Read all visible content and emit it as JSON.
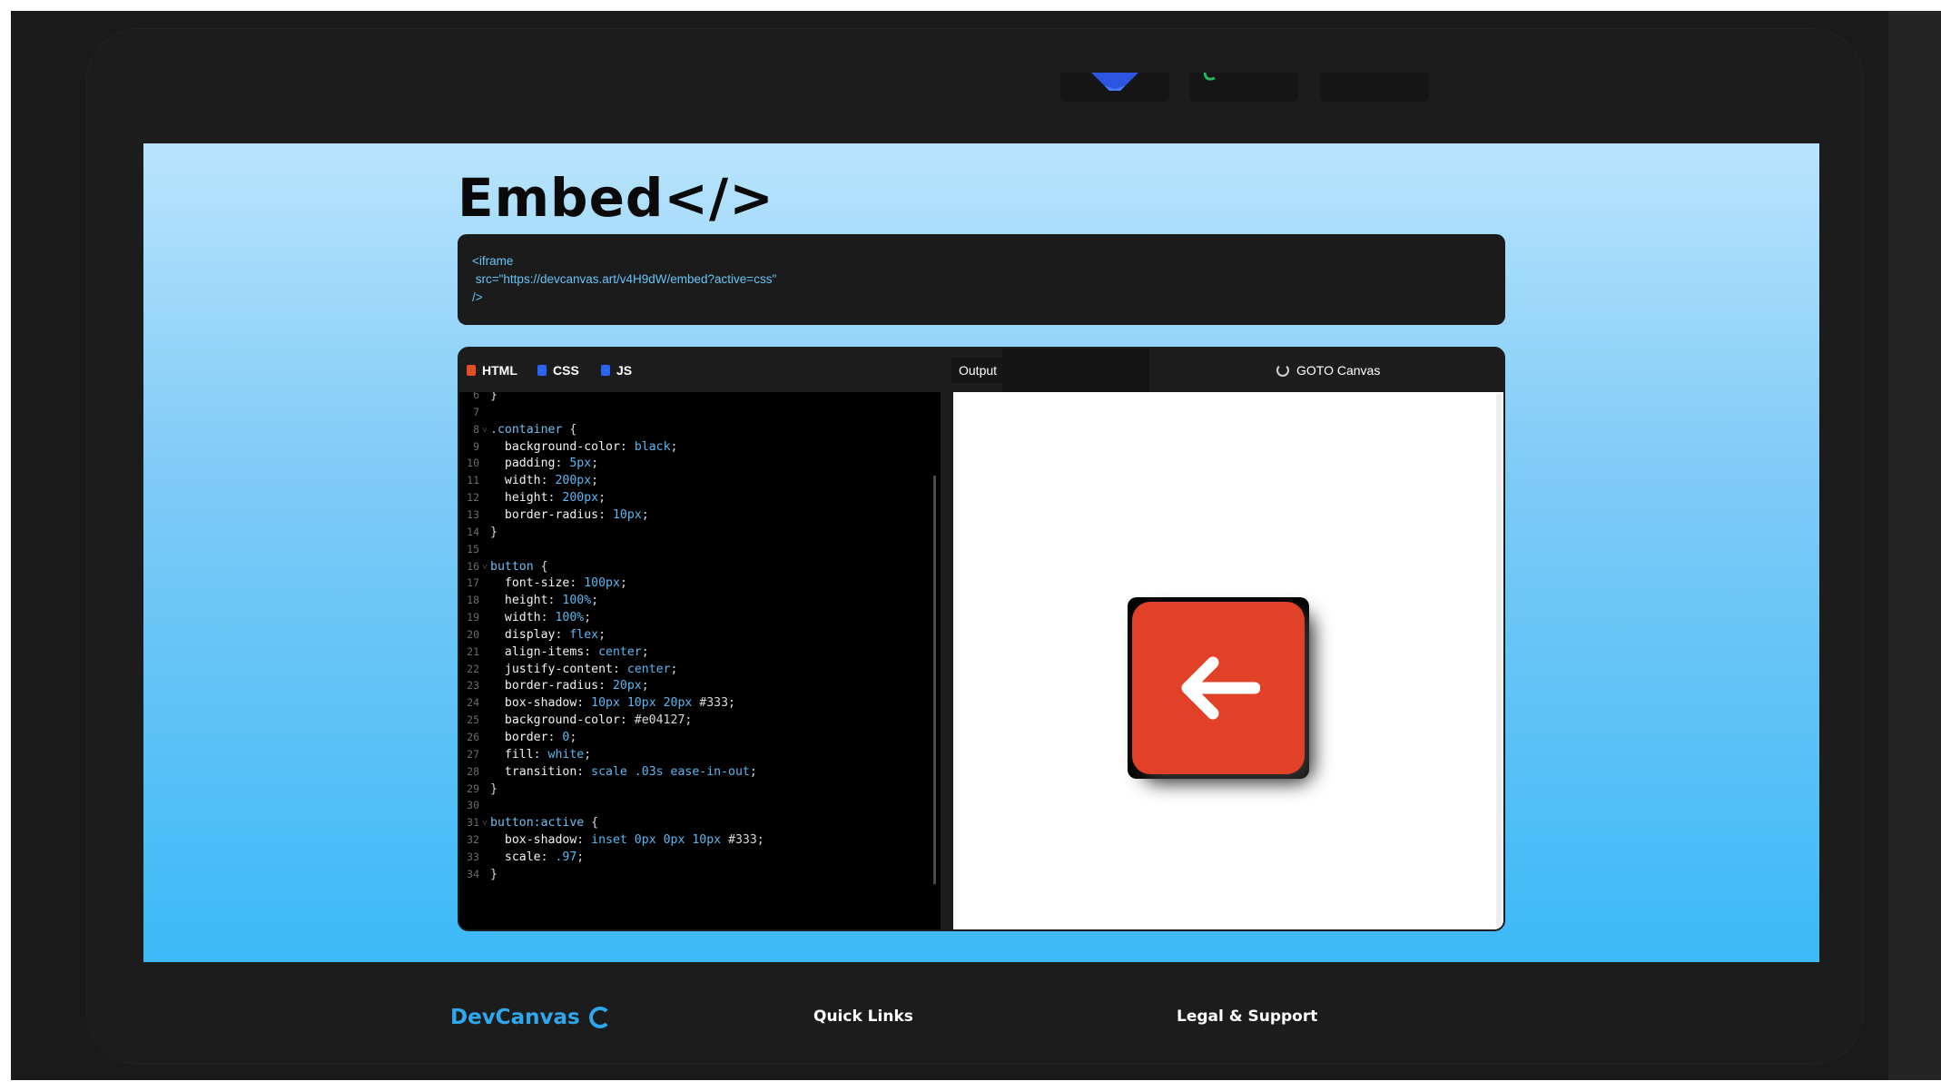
{
  "embed": {
    "title": "Embed</>",
    "code_lines": [
      "<iframe",
      " src=\"https://devcanvas.art/v4H9dW/embed?active=css\"",
      "/>"
    ]
  },
  "editor": {
    "tabs": [
      {
        "label": "HTML",
        "icon": "html5-icon",
        "color": "#e44d26"
      },
      {
        "label": "CSS",
        "icon": "css3-icon",
        "color": "#2965f1"
      },
      {
        "label": "JS",
        "icon": "js-icon",
        "color": "#2965f1"
      }
    ],
    "output_label": "Output",
    "goto_label": "GOTO Canvas",
    "code": [
      {
        "n": "6",
        "fold": "",
        "t": [
          [
            "punc",
            "}"
          ]
        ]
      },
      {
        "n": "7",
        "fold": "",
        "t": []
      },
      {
        "n": "8",
        "fold": "˅",
        "t": [
          [
            "sel",
            ".container"
          ],
          [
            "punc",
            " {"
          ]
        ]
      },
      {
        "n": "9",
        "fold": "",
        "t": [
          [
            "prop",
            "  background-color"
          ],
          [
            "punc",
            ": "
          ],
          [
            "val",
            "black"
          ],
          [
            "punc",
            ";"
          ]
        ]
      },
      {
        "n": "10",
        "fold": "",
        "t": [
          [
            "prop",
            "  padding"
          ],
          [
            "punc",
            ": "
          ],
          [
            "val",
            "5px"
          ],
          [
            "punc",
            ";"
          ]
        ]
      },
      {
        "n": "11",
        "fold": "",
        "t": [
          [
            "prop",
            "  width"
          ],
          [
            "punc",
            ": "
          ],
          [
            "val",
            "200px"
          ],
          [
            "punc",
            ";"
          ]
        ]
      },
      {
        "n": "12",
        "fold": "",
        "t": [
          [
            "prop",
            "  height"
          ],
          [
            "punc",
            ": "
          ],
          [
            "val",
            "200px"
          ],
          [
            "punc",
            ";"
          ]
        ]
      },
      {
        "n": "13",
        "fold": "",
        "t": [
          [
            "prop",
            "  border-radius"
          ],
          [
            "punc",
            ": "
          ],
          [
            "val",
            "10px"
          ],
          [
            "punc",
            ";"
          ]
        ]
      },
      {
        "n": "14",
        "fold": "",
        "t": [
          [
            "punc",
            "}"
          ]
        ]
      },
      {
        "n": "15",
        "fold": "",
        "t": []
      },
      {
        "n": "16",
        "fold": "˅",
        "t": [
          [
            "sel",
            "button"
          ],
          [
            "punc",
            " {"
          ]
        ]
      },
      {
        "n": "17",
        "fold": "",
        "t": [
          [
            "prop",
            "  font-size"
          ],
          [
            "punc",
            ": "
          ],
          [
            "val",
            "100px"
          ],
          [
            "punc",
            ";"
          ]
        ]
      },
      {
        "n": "18",
        "fold": "",
        "t": [
          [
            "prop",
            "  height"
          ],
          [
            "punc",
            ": "
          ],
          [
            "val",
            "100%"
          ],
          [
            "punc",
            ";"
          ]
        ]
      },
      {
        "n": "19",
        "fold": "",
        "t": [
          [
            "prop",
            "  width"
          ],
          [
            "punc",
            ": "
          ],
          [
            "val",
            "100%"
          ],
          [
            "punc",
            ";"
          ]
        ]
      },
      {
        "n": "20",
        "fold": "",
        "t": [
          [
            "prop",
            "  display"
          ],
          [
            "punc",
            ": "
          ],
          [
            "val",
            "flex"
          ],
          [
            "punc",
            ";"
          ]
        ]
      },
      {
        "n": "21",
        "fold": "",
        "t": [
          [
            "prop",
            "  align-items"
          ],
          [
            "punc",
            ": "
          ],
          [
            "val",
            "center"
          ],
          [
            "punc",
            ";"
          ]
        ]
      },
      {
        "n": "22",
        "fold": "",
        "t": [
          [
            "prop",
            "  justify-content"
          ],
          [
            "punc",
            ": "
          ],
          [
            "val",
            "center"
          ],
          [
            "punc",
            ";"
          ]
        ]
      },
      {
        "n": "23",
        "fold": "",
        "t": [
          [
            "prop",
            "  border-radius"
          ],
          [
            "punc",
            ": "
          ],
          [
            "val",
            "20px"
          ],
          [
            "punc",
            ";"
          ]
        ]
      },
      {
        "n": "24",
        "fold": "",
        "t": [
          [
            "prop",
            "  box-shadow"
          ],
          [
            "punc",
            ": "
          ],
          [
            "val",
            "10px 10px 20px"
          ],
          [
            "punc",
            " #333;"
          ]
        ]
      },
      {
        "n": "25",
        "fold": "",
        "t": [
          [
            "prop",
            "  background-color"
          ],
          [
            "punc",
            ": #e04127;"
          ]
        ]
      },
      {
        "n": "26",
        "fold": "",
        "t": [
          [
            "prop",
            "  border"
          ],
          [
            "punc",
            ": "
          ],
          [
            "val",
            "0"
          ],
          [
            "punc",
            ";"
          ]
        ]
      },
      {
        "n": "27",
        "fold": "",
        "t": [
          [
            "prop",
            "  fill"
          ],
          [
            "punc",
            ": "
          ],
          [
            "val",
            "white"
          ],
          [
            "punc",
            ";"
          ]
        ]
      },
      {
        "n": "28",
        "fold": "",
        "t": [
          [
            "prop",
            "  transition"
          ],
          [
            "punc",
            ": "
          ],
          [
            "val",
            "scale .03s ease-in-out"
          ],
          [
            "punc",
            ";"
          ]
        ]
      },
      {
        "n": "29",
        "fold": "",
        "t": [
          [
            "punc",
            "}"
          ]
        ]
      },
      {
        "n": "30",
        "fold": "",
        "t": []
      },
      {
        "n": "31",
        "fold": "˅",
        "t": [
          [
            "sel",
            "button:active"
          ],
          [
            "punc",
            " {"
          ]
        ]
      },
      {
        "n": "32",
        "fold": "",
        "t": [
          [
            "prop",
            "  box-shadow"
          ],
          [
            "punc",
            ": "
          ],
          [
            "val",
            "inset 0px 0px 10px"
          ],
          [
            "punc",
            " #333;"
          ]
        ]
      },
      {
        "n": "33",
        "fold": "",
        "t": [
          [
            "prop",
            "  scale"
          ],
          [
            "punc",
            ": "
          ],
          [
            "val",
            ".97"
          ],
          [
            "punc",
            ";"
          ]
        ]
      },
      {
        "n": "34",
        "fold": "",
        "t": [
          [
            "punc",
            "}"
          ]
        ]
      }
    ]
  },
  "output": {
    "button_icon": "arrow-left-icon",
    "button_color": "#e04127"
  },
  "footer": {
    "brand": "DevCanvas",
    "brand_icon": "spinner-icon",
    "quick_links": "Quick Links",
    "legal": "Legal & Support"
  },
  "colors": {
    "accent": "#2fa7ee",
    "code_value": "#5db6f2"
  }
}
